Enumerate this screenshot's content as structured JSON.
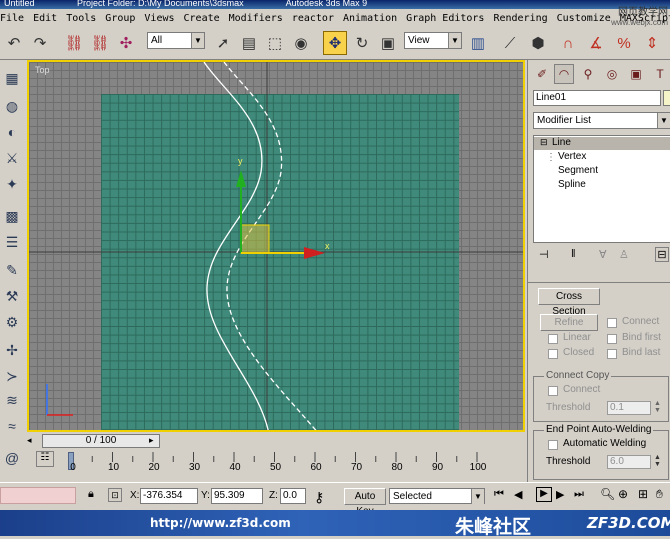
{
  "title_fragments": [
    "Untitled",
    "Project Folder: D:\\My Documents\\3dsmax",
    "Autodesk 3ds Max 9"
  ],
  "watermark_site": "网页教学网",
  "watermark_sub": "www.webjx.com",
  "menu": [
    "File",
    "Edit",
    "Tools",
    "Group",
    "Views",
    "Create",
    "Modifiers",
    "reactor",
    "Animation",
    "Graph Editors",
    "Rendering",
    "Customize",
    "MAXScript"
  ],
  "toolbar": {
    "selection_filter": "All",
    "ref_coord": "View",
    "icons": [
      "undo-icon",
      "redo-icon",
      "select-link-icon",
      "unlink-icon",
      "bind-spacewarp-icon",
      "select-object-icon",
      "select-by-name-icon",
      "rect-region-icon",
      "window-crossing-icon",
      "move-icon",
      "rotate-icon",
      "scale-icon",
      "pivot-icon",
      "mirror-icon",
      "align-icon",
      "snap-icon",
      "angle-snap-icon",
      "percent-snap-icon",
      "spinner-snap-icon"
    ]
  },
  "viewport": {
    "label": "Top",
    "gizmo_y": "y",
    "gizmo_x": "x",
    "border_color": "#f0d000",
    "plane_color": "#3f8a7a"
  },
  "timeline": {
    "slider_text": "0 / 100",
    "ticks": [
      "0",
      "10",
      "20",
      "30",
      "40",
      "50",
      "60",
      "70",
      "80",
      "90",
      "100"
    ]
  },
  "status": {
    "x_label": "X:",
    "x_value": "-376.354",
    "y_label": "Y:",
    "y_value": "95.309",
    "z_label": "Z:",
    "z_value": "0.0",
    "autokey_label": "Auto Key",
    "selected_dropdown": "Selected"
  },
  "banner": {
    "url": "http://www.zf3d.com",
    "brand_cn": "朱峰社区",
    "brand_en": "ZF3D.COM"
  },
  "panel": {
    "object_name": "Line01",
    "modifier_list": "Modifier List",
    "stack_root": "Line",
    "stack_items": [
      "Vertex",
      "Segment",
      "Spline"
    ],
    "cross_section_button": "Cross Section",
    "refine_button": "Refine",
    "connect_check": "Connect",
    "linear_check": "Linear",
    "bind_first_check": "Bind first",
    "closed_check": "Closed",
    "bind_last_check": "Bind last",
    "connect_copy_title": "Connect Copy",
    "connect_copy_check": "Connect",
    "threshold_label": "Threshold",
    "threshold_value": "0.1",
    "auto_weld_title": "End Point Auto-Welding",
    "auto_weld_check": "Automatic Welding",
    "threshold2_label": "Threshold",
    "threshold2_value": "6.0"
  }
}
